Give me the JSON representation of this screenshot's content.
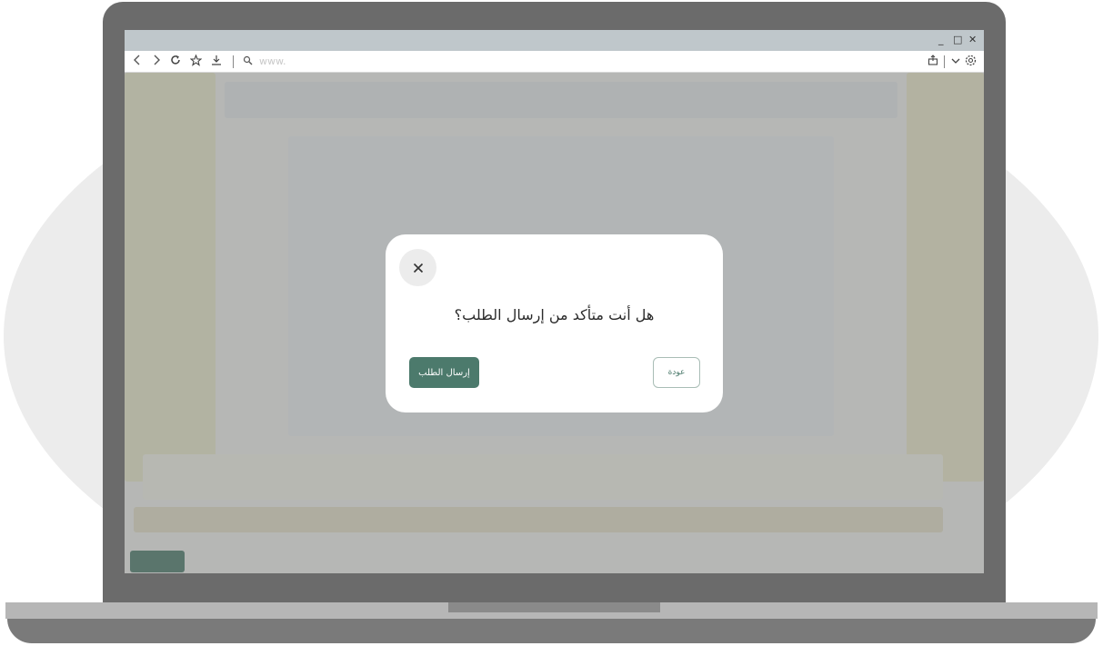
{
  "browser": {
    "window_controls": {
      "minimize": "_",
      "maximize": "□",
      "close": "✕"
    },
    "url_placeholder": "www.",
    "icons": [
      "back-icon",
      "forward-icon",
      "reload-icon",
      "star-icon",
      "download-icon",
      "search-icon",
      "share-icon",
      "chevron-down-icon",
      "settings-icon"
    ]
  },
  "dialog": {
    "close_label": "×",
    "question": "هل أنت متأكد من إرسال الطلب؟",
    "submit_label": "إرسال الطلب",
    "back_label": "عودة"
  },
  "colors": {
    "primary": "#4c7a6c",
    "laptop_frame": "#6b6b6b",
    "overlay": "#6e6e6e"
  }
}
